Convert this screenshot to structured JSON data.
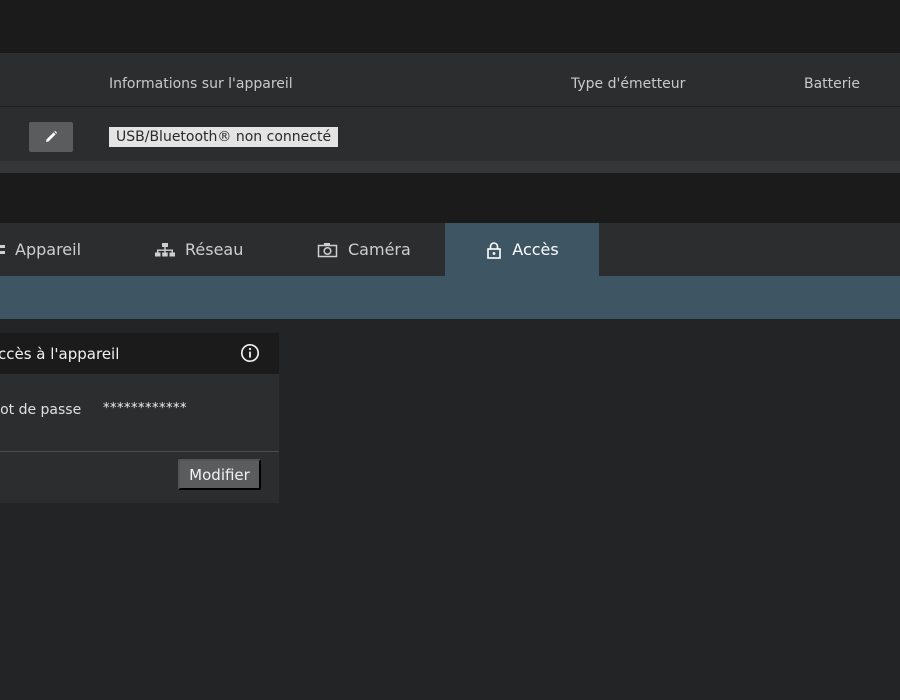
{
  "device_table": {
    "headers": {
      "info": "Informations sur l'appareil",
      "transmitter_type": "Type d'émetteur",
      "battery": "Batterie"
    },
    "row": {
      "status": "USB/Bluetooth® non connecté"
    }
  },
  "tabs": [
    {
      "label": "Appareil",
      "icon": "device-icon"
    },
    {
      "label": "Réseau",
      "icon": "network-icon"
    },
    {
      "label": "Caméra",
      "icon": "camera-icon"
    },
    {
      "label": "Accès",
      "icon": "lock-icon",
      "active": true
    }
  ],
  "access_card": {
    "title": "Accès à l'appareil",
    "password_label": "Mot de passe",
    "password_value": "************",
    "modify_label": "Modifier"
  },
  "colors": {
    "accent": "#3e5564",
    "background": "#232426",
    "panel": "#2c2d2f",
    "bar": "#1b1b1c"
  }
}
